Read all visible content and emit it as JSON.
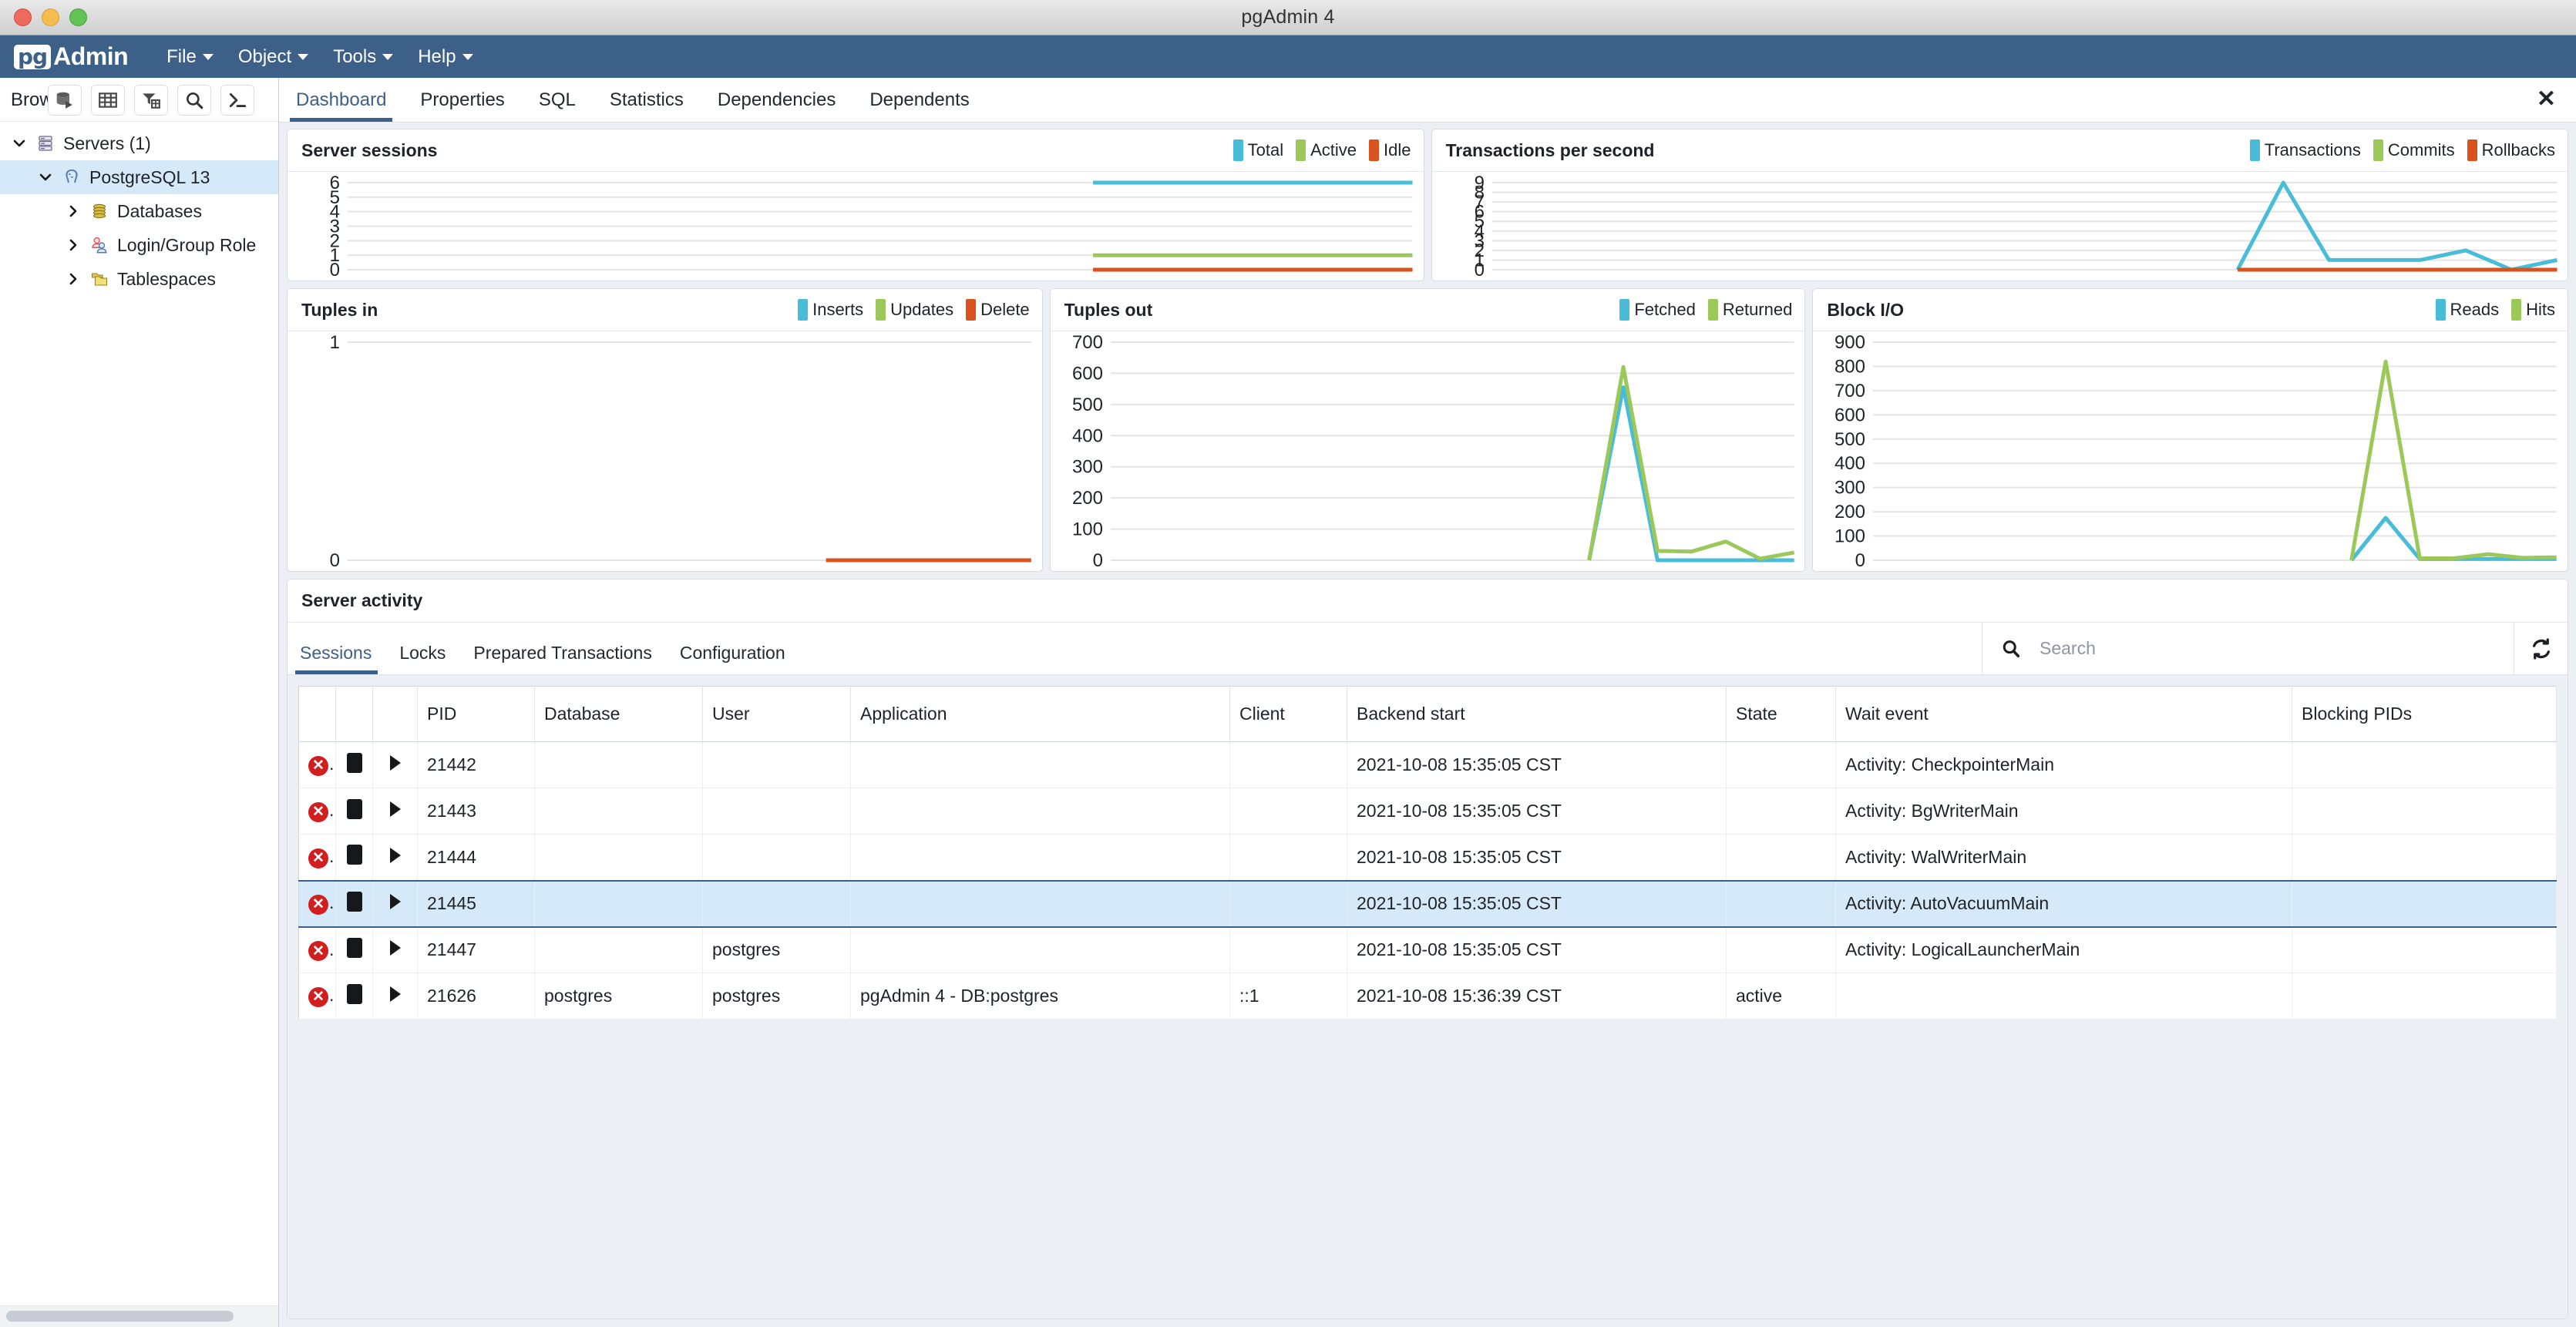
{
  "window": {
    "title": "pgAdmin 4"
  },
  "menubar": {
    "logo_pg": "pg",
    "logo_admin": "Admin",
    "items": [
      {
        "label": "File"
      },
      {
        "label": "Object"
      },
      {
        "label": "Tools"
      },
      {
        "label": "Help"
      }
    ]
  },
  "browser": {
    "label": "Browser",
    "toolbar_icons": [
      "connect-server-icon",
      "view-data-table-icon",
      "filtered-rows-icon",
      "search-objects-icon",
      "psql-terminal-icon"
    ],
    "tree": [
      {
        "label": "Servers (1)",
        "icon": "servers-icon",
        "expanded": true,
        "depth": 0,
        "selected": false
      },
      {
        "label": "PostgreSQL 13",
        "icon": "postgres-elephant-icon",
        "expanded": true,
        "depth": 1,
        "selected": true
      },
      {
        "label": "Databases",
        "icon": "databases-icon",
        "expanded": false,
        "depth": 2,
        "selected": false
      },
      {
        "label": "Login/Group Role",
        "icon": "login-group-roles-icon",
        "expanded": false,
        "depth": 2,
        "selected": false
      },
      {
        "label": "Tablespaces",
        "icon": "tablespaces-icon",
        "expanded": false,
        "depth": 2,
        "selected": false
      }
    ]
  },
  "tabs": {
    "items": [
      {
        "label": "Dashboard",
        "active": true
      },
      {
        "label": "Properties",
        "active": false
      },
      {
        "label": "SQL",
        "active": false
      },
      {
        "label": "Statistics",
        "active": false
      },
      {
        "label": "Dependencies",
        "active": false
      },
      {
        "label": "Dependents",
        "active": false
      }
    ],
    "close_label": "✕"
  },
  "colors": {
    "blue": "#49bcd8",
    "green": "#9cc85a",
    "orange": "#d9521e",
    "accent": "#3c6088",
    "grid": "#e4e4e4"
  },
  "chart_data": [
    {
      "type": "line",
      "title": "Server sessions",
      "ylabel": "",
      "xlabel": "",
      "ylim": [
        0,
        6
      ],
      "yticks": [
        0,
        1,
        2,
        3,
        4,
        5,
        6
      ],
      "grid": true,
      "legend_position": "top-right",
      "series": [
        {
          "name": "Total",
          "color": "#49bcd8",
          "values": [
            6,
            6,
            6,
            6,
            6,
            6
          ]
        },
        {
          "name": "Active",
          "color": "#9cc85a",
          "values": [
            1,
            1,
            1,
            1,
            1,
            1
          ]
        },
        {
          "name": "Idle",
          "color": "#d9521e",
          "values": [
            0,
            0,
            0,
            0,
            0,
            0
          ]
        }
      ]
    },
    {
      "type": "line",
      "title": "Transactions per second",
      "ylabel": "",
      "xlabel": "",
      "ylim": [
        0,
        9
      ],
      "yticks": [
        0,
        1,
        2,
        3,
        4,
        5,
        6,
        7,
        8,
        9
      ],
      "grid": true,
      "legend_position": "top-right",
      "series": [
        {
          "name": "Transactions",
          "color": "#49bcd8",
          "values": [
            0,
            9,
            1,
            1,
            1,
            2,
            0,
            1
          ]
        },
        {
          "name": "Commits",
          "color": "#9cc85a",
          "values": [
            0,
            0,
            0,
            0,
            0,
            0,
            0,
            0
          ]
        },
        {
          "name": "Rollbacks",
          "color": "#d9521e",
          "values": [
            0,
            0,
            0,
            0,
            0,
            0,
            0,
            0
          ]
        }
      ]
    },
    {
      "type": "line",
      "title": "Tuples in",
      "ylabel": "",
      "xlabel": "",
      "ylim": [
        0,
        1
      ],
      "yticks": [
        0,
        1
      ],
      "grid": true,
      "legend_position": "top-right",
      "series": [
        {
          "name": "Inserts",
          "color": "#49bcd8",
          "values": [
            0,
            0,
            0,
            0
          ]
        },
        {
          "name": "Updates",
          "color": "#9cc85a",
          "values": [
            0,
            0,
            0,
            0
          ]
        },
        {
          "name": "Delete",
          "color": "#d9521e",
          "values": [
            0,
            0,
            0,
            0
          ]
        }
      ]
    },
    {
      "type": "line",
      "title": "Tuples out",
      "ylabel": "",
      "xlabel": "",
      "ylim": [
        0,
        700
      ],
      "yticks": [
        0,
        100,
        200,
        300,
        400,
        500,
        600,
        700
      ],
      "grid": true,
      "legend_position": "top-right",
      "series": [
        {
          "name": "Fetched",
          "color": "#49bcd8",
          "values": [
            0,
            555,
            0,
            0,
            0,
            0,
            0
          ]
        },
        {
          "name": "Returned",
          "color": "#9cc85a",
          "values": [
            0,
            620,
            30,
            28,
            60,
            5,
            25
          ]
        }
      ]
    },
    {
      "type": "line",
      "title": "Block I/O",
      "ylabel": "",
      "xlabel": "",
      "ylim": [
        0,
        900
      ],
      "yticks": [
        0,
        100,
        200,
        300,
        400,
        500,
        600,
        700,
        800,
        900
      ],
      "grid": true,
      "legend_position": "top-right",
      "series": [
        {
          "name": "Reads",
          "color": "#49bcd8",
          "values": [
            0,
            175,
            5,
            5,
            5,
            5,
            5
          ]
        },
        {
          "name": "Hits",
          "color": "#9cc85a",
          "values": [
            0,
            820,
            8,
            8,
            25,
            10,
            12
          ]
        }
      ]
    }
  ],
  "server_activity": {
    "title": "Server activity",
    "tabs": [
      {
        "label": "Sessions",
        "active": true
      },
      {
        "label": "Locks",
        "active": false
      },
      {
        "label": "Prepared Transactions",
        "active": false
      },
      {
        "label": "Configuration",
        "active": false
      }
    ],
    "search": {
      "placeholder": "Search",
      "value": ""
    },
    "refresh_icon": "refresh-icon",
    "columns": [
      "",
      "",
      "",
      "PID",
      "Database",
      "User",
      "Application",
      "Client",
      "Backend start",
      "State",
      "Wait event",
      "Blocking PIDs"
    ],
    "rows": [
      {
        "selected": false,
        "pid": "21442",
        "database": "",
        "user": "",
        "application": "",
        "client": "",
        "backend_start": "2021-10-08 15:35:05 CST",
        "state": "",
        "wait_event": "Activity: CheckpointerMain",
        "blocking_pids": ""
      },
      {
        "selected": false,
        "pid": "21443",
        "database": "",
        "user": "",
        "application": "",
        "client": "",
        "backend_start": "2021-10-08 15:35:05 CST",
        "state": "",
        "wait_event": "Activity: BgWriterMain",
        "blocking_pids": ""
      },
      {
        "selected": false,
        "pid": "21444",
        "database": "",
        "user": "",
        "application": "",
        "client": "",
        "backend_start": "2021-10-08 15:35:05 CST",
        "state": "",
        "wait_event": "Activity: WalWriterMain",
        "blocking_pids": ""
      },
      {
        "selected": true,
        "pid": "21445",
        "database": "",
        "user": "",
        "application": "",
        "client": "",
        "backend_start": "2021-10-08 15:35:05 CST",
        "state": "",
        "wait_event": "Activity: AutoVacuumMain",
        "blocking_pids": ""
      },
      {
        "selected": false,
        "pid": "21447",
        "database": "",
        "user": "postgres",
        "application": "",
        "client": "",
        "backend_start": "2021-10-08 15:35:05 CST",
        "state": "",
        "wait_event": "Activity: LogicalLauncherMain",
        "blocking_pids": ""
      },
      {
        "selected": false,
        "pid": "21626",
        "database": "postgres",
        "user": "postgres",
        "application": "pgAdmin 4 - DB:postgres",
        "client": "::1",
        "backend_start": "2021-10-08 15:36:39 CST",
        "state": "active",
        "wait_event": "",
        "blocking_pids": ""
      }
    ],
    "row_action_icons": [
      "terminate-session-icon",
      "cancel-query-icon",
      "expand-row-icon"
    ]
  }
}
